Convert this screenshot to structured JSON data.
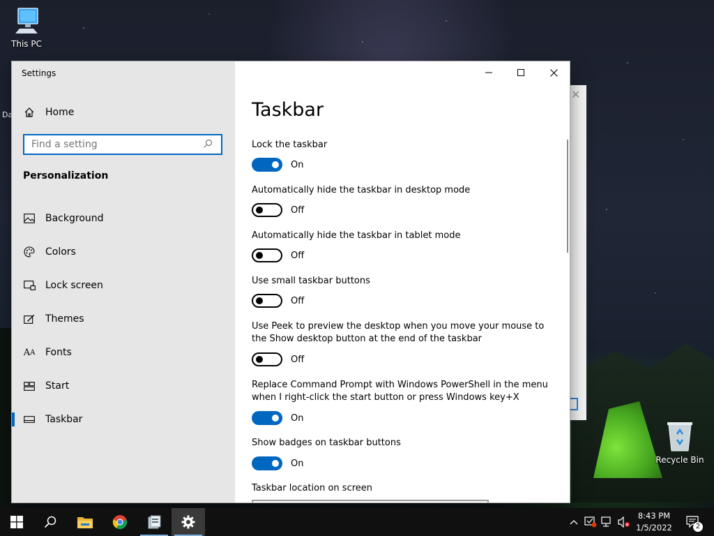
{
  "desktop": {
    "icons": [
      {
        "label": "This PC"
      },
      {
        "label": "Recycle Bin"
      }
    ],
    "left_edge_label": "Da"
  },
  "window": {
    "title": "Settings",
    "controls": {
      "minimize": "minimize-icon",
      "maximize": "maximize-icon",
      "close": "close-icon"
    }
  },
  "sidebar": {
    "home_label": "Home",
    "search_placeholder": "Find a setting",
    "section_title": "Personalization",
    "items": [
      {
        "label": "Background",
        "icon": "picture-icon"
      },
      {
        "label": "Colors",
        "icon": "palette-icon"
      },
      {
        "label": "Lock screen",
        "icon": "lock-screen-icon"
      },
      {
        "label": "Themes",
        "icon": "themes-icon"
      },
      {
        "label": "Fonts",
        "icon": "fonts-icon"
      },
      {
        "label": "Start",
        "icon": "start-icon"
      },
      {
        "label": "Taskbar",
        "icon": "taskbar-icon",
        "active": true
      }
    ]
  },
  "content": {
    "title": "Taskbar",
    "settings": [
      {
        "label": "Lock the taskbar",
        "state": "On"
      },
      {
        "label": "Automatically hide the taskbar in desktop mode",
        "state": "Off"
      },
      {
        "label": "Automatically hide the taskbar in tablet mode",
        "state": "Off"
      },
      {
        "label": "Use small taskbar buttons",
        "state": "Off"
      },
      {
        "label": "Use Peek to preview the desktop when you move your mouse to the Show desktop button at the end of the taskbar",
        "state": "Off"
      },
      {
        "label": "Replace Command Prompt with Windows PowerShell in the menu when I right-click the start button or press Windows key+X",
        "state": "On"
      },
      {
        "label": "Show badges on taskbar buttons",
        "state": "On"
      }
    ],
    "location_label": "Taskbar location on screen"
  },
  "taskbar": {
    "apps": [
      "start-icon",
      "search-icon",
      "file-explorer-icon",
      "chrome-icon",
      "app-icon",
      "settings-icon"
    ],
    "clock_time": "8:43 PM",
    "clock_date": "1/5/2022",
    "notification_count": "2",
    "accent": "#0067c0"
  }
}
